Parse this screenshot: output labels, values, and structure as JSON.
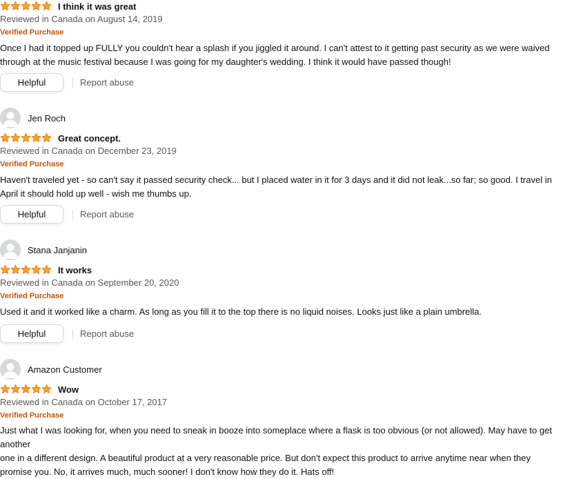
{
  "colors": {
    "star_fill": "#ffa41c",
    "star_stroke": "#de7921",
    "verified": "#c45500",
    "muted_text": "#565959",
    "avatar_bg": "#d5d9d9"
  },
  "reviews": [
    {
      "reviewer": "",
      "rating": 5,
      "title": "I think it was great",
      "date": "Reviewed in Canada on August 14, 2019",
      "verified": "Verified Purchase",
      "body_lines": [
        "Once I had it topped up FULLY you couldn't hear a splash if you jiggled it around. I can't attest to it getting past security as we were waived",
        "through at the music festival because I was going for my daughter's wedding. I think it would have passed though!"
      ],
      "helpful_label": "Helpful",
      "report_label": "Report abuse"
    },
    {
      "reviewer": "Jen Roch",
      "rating": 5,
      "title": "Great concept.",
      "date": "Reviewed in Canada on December 23, 2019",
      "verified": "Verified Purchase",
      "body_lines": [
        "Haven't traveled yet - so can't say it passed security check... but I placed water in it for 3 days and it did not leak...so far; so good. I travel in",
        "April it should hold up well - wish me thumbs up."
      ],
      "helpful_label": "Helpful",
      "report_label": "Report abuse"
    },
    {
      "reviewer": "Stana Janjanin",
      "rating": 5,
      "title": "It works",
      "date": "Reviewed in Canada on September 20, 2020",
      "verified": "Verified Purchase",
      "body_lines": [
        "Used it and it worked like a charm. As long as you fill it to the top there is no liquid noises. Looks just like a plain umbrella."
      ],
      "helpful_label": "Helpful",
      "report_label": "Report abuse"
    },
    {
      "reviewer": "Amazon Customer",
      "rating": 5,
      "title": "Wow",
      "date": "Reviewed in Canada on October 17, 2017",
      "verified": "Verified Purchase",
      "body_lines": [
        "Just what I was looking for, when you need to sneak in booze into someplace where a flask is too obvious (or not allowed). May have to get",
        "another",
        "one in a different design. A beautiful product at a very reasonable price. But don't expect this product to arrive anytime near when they",
        "promise you. No, it arrives much, much sooner! I don't know how they do it. Hats off!"
      ]
    }
  ]
}
